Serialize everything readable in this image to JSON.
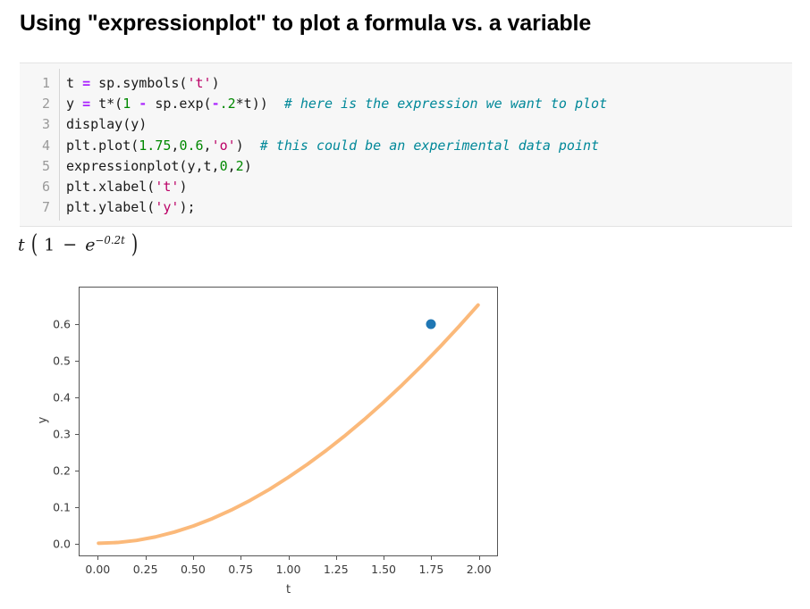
{
  "title": "Using \"expressionplot\" to plot a formula vs. a variable",
  "code": {
    "language": "python",
    "background": "#f7f7f7",
    "lines": [
      {
        "number": "1",
        "tokens": [
          {
            "t": "t ",
            "k": "plain"
          },
          {
            "t": "=",
            "k": "op"
          },
          {
            "t": " sp.symbols(",
            "k": "plain"
          },
          {
            "t": "'t'",
            "k": "str"
          },
          {
            "t": ")",
            "k": "plain"
          }
        ]
      },
      {
        "number": "2",
        "tokens": [
          {
            "t": "y ",
            "k": "plain"
          },
          {
            "t": "=",
            "k": "op"
          },
          {
            "t": " t*(",
            "k": "plain"
          },
          {
            "t": "1",
            "k": "num"
          },
          {
            "t": " ",
            "k": "plain"
          },
          {
            "t": "-",
            "k": "op"
          },
          {
            "t": " sp.exp(",
            "k": "plain"
          },
          {
            "t": "-",
            "k": "op"
          },
          {
            "t": ".2",
            "k": "num"
          },
          {
            "t": "*t))  ",
            "k": "plain"
          },
          {
            "t": "# here is the expression we want to plot",
            "k": "cmt"
          }
        ]
      },
      {
        "number": "3",
        "tokens": [
          {
            "t": "display(y)",
            "k": "plain"
          }
        ]
      },
      {
        "number": "4",
        "tokens": [
          {
            "t": "plt.plot(",
            "k": "plain"
          },
          {
            "t": "1.75",
            "k": "num"
          },
          {
            "t": ",",
            "k": "plain"
          },
          {
            "t": "0.6",
            "k": "num"
          },
          {
            "t": ",",
            "k": "plain"
          },
          {
            "t": "'o'",
            "k": "str"
          },
          {
            "t": ")  ",
            "k": "plain"
          },
          {
            "t": "# this could be an experimental data point",
            "k": "cmt"
          }
        ]
      },
      {
        "number": "5",
        "tokens": [
          {
            "t": "expressionplot(y,t,",
            "k": "plain"
          },
          {
            "t": "0",
            "k": "num"
          },
          {
            "t": ",",
            "k": "plain"
          },
          {
            "t": "2",
            "k": "num"
          },
          {
            "t": ")",
            "k": "plain"
          }
        ]
      },
      {
        "number": "6",
        "tokens": [
          {
            "t": "plt.xlabel(",
            "k": "plain"
          },
          {
            "t": "'t'",
            "k": "str"
          },
          {
            "t": ")",
            "k": "plain"
          }
        ]
      },
      {
        "number": "7",
        "tokens": [
          {
            "t": "plt.ylabel(",
            "k": "plain"
          },
          {
            "t": "'y'",
            "k": "str"
          },
          {
            "t": ");",
            "k": "plain"
          }
        ]
      }
    ]
  },
  "math_output": {
    "plain": "t (1 - e^(-0.2t))",
    "var": "t",
    "open_paren": "(",
    "one": "1",
    "minus": "−",
    "base": "e",
    "exponent": "−0.2t",
    "close_paren": ")"
  },
  "chart_data": {
    "type": "line",
    "title": "",
    "xlabel": "t",
    "ylabel": "y",
    "xlim": [
      -0.1,
      2.1
    ],
    "ylim": [
      -0.0335,
      0.703
    ],
    "grid": false,
    "legend": null,
    "xticks": [
      "0.00",
      "0.25",
      "0.50",
      "0.75",
      "1.00",
      "1.25",
      "1.50",
      "1.75",
      "2.00"
    ],
    "xtick_values": [
      0,
      0.25,
      0.5,
      0.75,
      1.0,
      1.25,
      1.5,
      1.75,
      2.0
    ],
    "yticks": [
      "0.0",
      "0.1",
      "0.2",
      "0.3",
      "0.4",
      "0.5",
      "0.6"
    ],
    "ytick_values": [
      0.0,
      0.1,
      0.2,
      0.3,
      0.4,
      0.5,
      0.6
    ],
    "series": [
      {
        "name": "t*(1 - exp(-0.2*t))",
        "kind": "line",
        "color": "#fbb97a",
        "linewidth": 4,
        "x": [
          0,
          0.1,
          0.2,
          0.3,
          0.4,
          0.5,
          0.6,
          0.7,
          0.8,
          0.9,
          1.0,
          1.1,
          1.2,
          1.3,
          1.4,
          1.5,
          1.6,
          1.7,
          1.8,
          1.9,
          2.0
        ],
        "y": [
          0.0,
          0.00198,
          0.00784,
          0.01747,
          0.03075,
          0.04758,
          0.06784,
          0.09141,
          0.11818,
          0.14804,
          0.18127,
          0.21687,
          0.25526,
          0.29637,
          0.34013,
          0.38648,
          0.43535,
          0.48669,
          0.54043,
          0.59653,
          0.65493
        ]
      },
      {
        "name": "experimental data point",
        "kind": "scatter",
        "color": "#1f77b4",
        "marker": "o",
        "x": [
          1.75
        ],
        "y": [
          0.6
        ]
      }
    ]
  }
}
